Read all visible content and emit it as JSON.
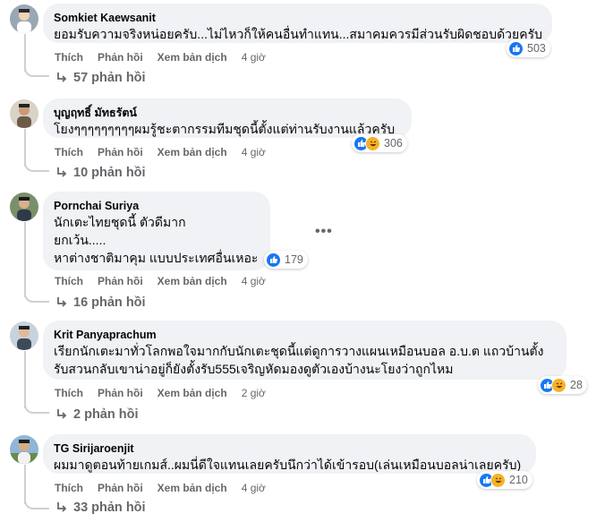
{
  "colors": {
    "bubble_bg": "#f0f2f5",
    "meta_text": "#65676b",
    "like_blue": "#1877f2",
    "haha_yellow": "#f7b125",
    "thread_line": "#ced0d4"
  },
  "comments": [
    {
      "author": "Somkiet Kaewsanit",
      "lines": [
        "ยอมรับความจริงหน่อยครับ...ไม่ไหวก็ให้คนอื่นทำแทน...สมาคมควรมีส่วนรับผิดชอบด้วยครับ"
      ],
      "reaction_icons": [
        "like-icon"
      ],
      "reaction_count": "503",
      "actions": [
        "Thích",
        "Phản hồi",
        "Xem bản dịch"
      ],
      "time": "4 giờ",
      "replies": "57 phản hồi"
    },
    {
      "author": "บุญฤทธิ์ มัทธรัตน์",
      "lines": [
        "โยงๆๆๆๆๆๆๆๆๆผมรู้ชะตากรรมทีมชุดนี้ตั้งแต่ท่านรับงานแล้วครับ"
      ],
      "reaction_icons": [
        "like-icon",
        "haha-icon"
      ],
      "reaction_count": "306",
      "actions": [
        "Thích",
        "Phản hồi",
        "Xem bản dịch"
      ],
      "time": "4 giờ",
      "replies": "10 phản hồi"
    },
    {
      "author": "Pornchai Suriya",
      "lines": [
        "นักเตะไทยชุดนี้ ตัวดีมาก",
        "ยกเว้น.....",
        "หาต่างชาติมาคุม แบบประเทศอื่นเหอะ"
      ],
      "reaction_icons": [
        "like-icon"
      ],
      "reaction_count": "179",
      "actions": [
        "Thích",
        "Phản hồi",
        "Xem bản dịch"
      ],
      "time": "4 giờ",
      "replies": "16 phản hồi"
    },
    {
      "author": "Krit Panyaprachum",
      "lines": [
        "เรียกนักเตะมาทั่วโลกพอใจมากกับนักเตะชุดนี้แต่ดูการวางแผนเหมือนบอล อ.บ.ต แถวบ้านตั้ง",
        "รับสวนกลับเขาน่าอยู่ก็ยังตั้งรับ555เจริญหัดมองดูตัวเองบ้างนะโยงว่าถูกไหม"
      ],
      "reaction_icons": [
        "like-icon",
        "haha-icon"
      ],
      "reaction_count": "28",
      "actions": [
        "Thích",
        "Phản hồi",
        "Xem bản dịch"
      ],
      "time": "2 giờ",
      "replies": "2 phản hồi"
    },
    {
      "author": "TG Sirijaroenjit",
      "lines": [
        "ผมมาดูตอนท้ายเกมส์..ผมนี่ดีใจแทนเลยครับนึกว่าได้เข้ารอบ(เล่นเหมือนบอลน่าเลยครับ)"
      ],
      "reaction_icons": [
        "like-icon",
        "haha-icon"
      ],
      "reaction_count": "210",
      "actions": [
        "Thích",
        "Phản hồi",
        "Xem bản dịch"
      ],
      "time": "4 giờ",
      "replies": "33 phản hồi"
    }
  ],
  "more_menu": "•••"
}
